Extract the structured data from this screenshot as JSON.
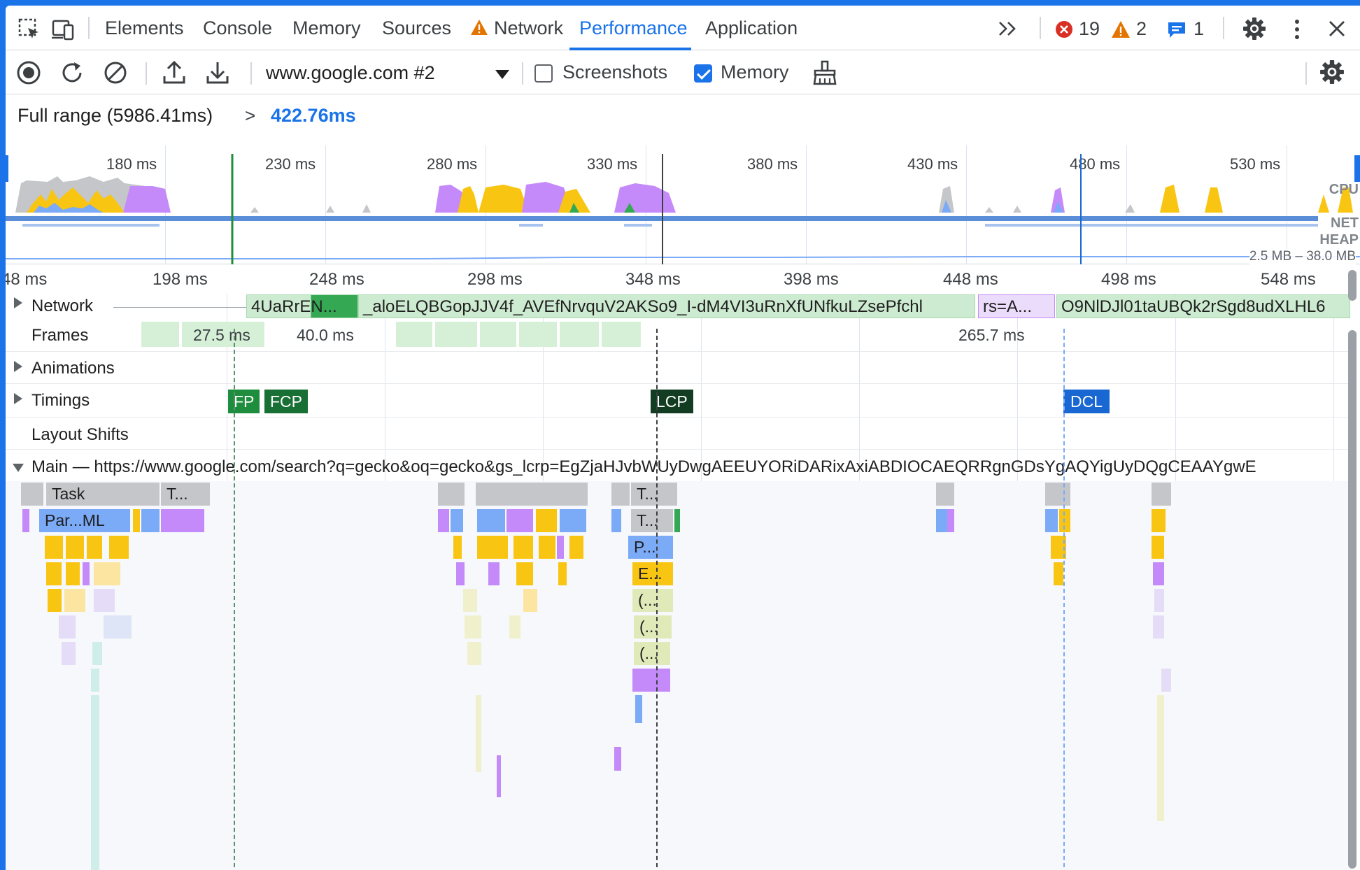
{
  "tabs": {
    "items": [
      {
        "label": "Elements"
      },
      {
        "label": "Console"
      },
      {
        "label": "Memory"
      },
      {
        "label": "Sources"
      },
      {
        "label": "Network",
        "warning": true
      },
      {
        "label": "Performance",
        "active": true
      },
      {
        "label": "Application"
      }
    ],
    "more_label": ">>",
    "errors": "19",
    "warnings": "2",
    "messages": "1"
  },
  "toolbar": {
    "target": "www.google.com #2",
    "screenshots_label": "Screenshots",
    "screenshots_checked": false,
    "memory_label": "Memory",
    "memory_checked": true
  },
  "breadcrumb": {
    "full_range": "Full range (5986.41ms)",
    "separator": ">",
    "current": "422.76ms"
  },
  "overview": {
    "ticks": [
      "180 ms",
      "230 ms",
      "280 ms",
      "330 ms",
      "380 ms",
      "430 ms",
      "480 ms",
      "530 ms"
    ],
    "cpu_label": "CPU",
    "net_label": "NET",
    "heap_label": "HEAP",
    "heap_range": "2.5 MB – 38.0 MB"
  },
  "flame": {
    "ticks": [
      "48 ms",
      "198 ms",
      "248 ms",
      "298 ms",
      "348 ms",
      "398 ms",
      "448 ms",
      "498 ms",
      "548 ms"
    ],
    "tracks": {
      "network": "Network",
      "frames": "Frames",
      "animations": "Animations",
      "timings": "Timings",
      "layout_shifts": "Layout Shifts",
      "main": "Main — https://www.google.com/search?q=gecko&oq=gecko&gs_lcrp=EgZjaHJvbWUyDwgAEEUYORiDARixAxiABDIOCAEQRRgnGDsYgAQYigUyDQgCEAAYgwE"
    },
    "network_requests": [
      "4UaRrEN...",
      "_aloELQBGopJJV4f_AVEfNrvquV2AKSo9_I-dM4VI3uRnXfUNfkuLZsePfchl",
      "rs=A...",
      "O9NlDJl01taUBQk2rSgd8udXLHL6"
    ],
    "frame_durations": [
      "27.5 ms",
      "40.0 ms",
      "265.7 ms"
    ],
    "timing_markers": [
      "FP",
      "FCP",
      "LCP",
      "DCL"
    ],
    "blocks": {
      "task_1": "Task",
      "task_2": "T...",
      "parse_html": "Par...ML",
      "task_3": "T...",
      "task_4": "T...",
      "p": "P...",
      "e": "E...",
      "anon_1": "(...",
      "anon_2": "(...",
      "anon_3": "(..."
    }
  },
  "colors": {
    "accent": "#1a73e8",
    "scripting": "#f9c513",
    "rendering": "#c58af9",
    "loading": "#7baaf7",
    "painting": "#34a853",
    "system": "#c4c6c9",
    "fp": "#1e8e3e",
    "fcp": "#187035",
    "lcp": "#123d22",
    "dcl": "#1967d2"
  }
}
